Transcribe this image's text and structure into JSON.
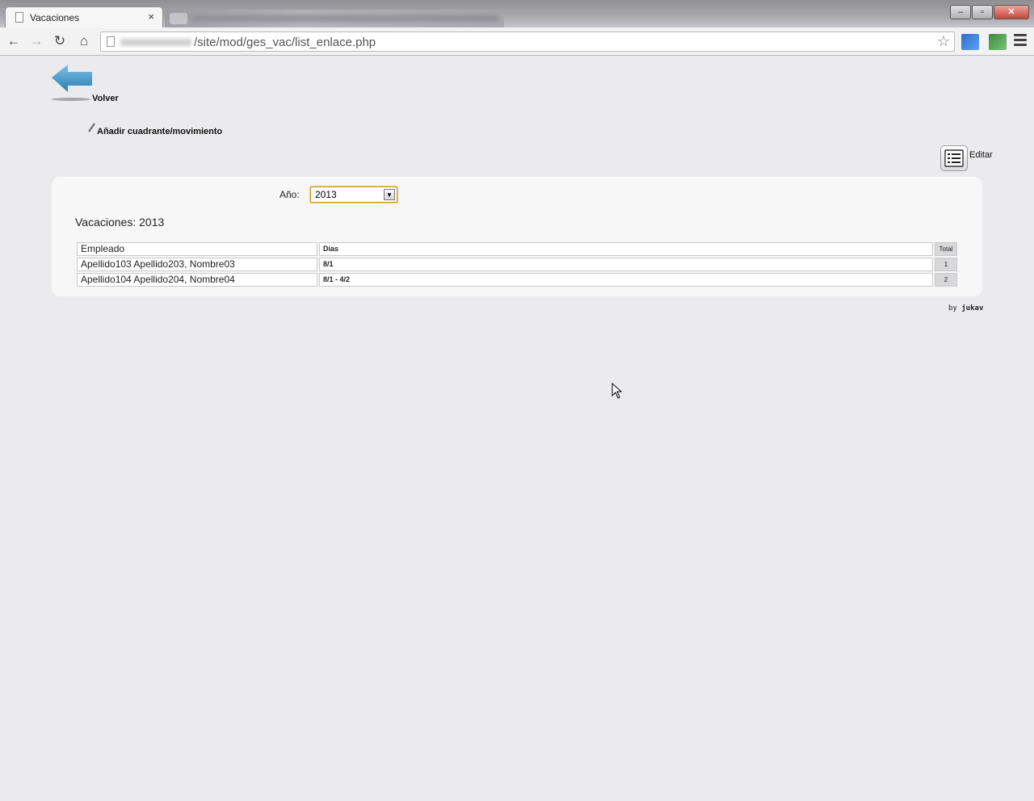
{
  "browser": {
    "tab_title": "Vacaciones",
    "tab_close": "×",
    "url_path": "/site/mod/ges_vac/list_enlace.php",
    "window_controls": {
      "minimize": "–",
      "restore": "▫",
      "close": "✕"
    },
    "icons": [
      "back-arrow-icon",
      "forward-arrow-icon",
      "reload-icon",
      "home-icon",
      "star-icon",
      "menu-icon"
    ]
  },
  "page": {
    "back_label": "Volver",
    "add_label": "Añadir cuadrante/movimiento",
    "edit_label": "Editar",
    "year_label": "Año:",
    "year_value": "2013",
    "section_title": "Vacaciones: 2013",
    "table": {
      "headers": [
        "Empleado",
        "Días",
        "Total"
      ],
      "rows": [
        [
          "Apellido103 Apellido203, Nombre03",
          "8/1",
          "1"
        ],
        [
          "Apellido104 Apellido204, Nombre04",
          "8/1 - 4/2",
          "2"
        ]
      ]
    },
    "credit_prefix": "by",
    "credit_author": "jukav"
  },
  "colors": {
    "background": "#ebebed",
    "panel": "#f7f7f7",
    "arrow": "#3d8fc0",
    "select_focus": "#c89a2b"
  }
}
